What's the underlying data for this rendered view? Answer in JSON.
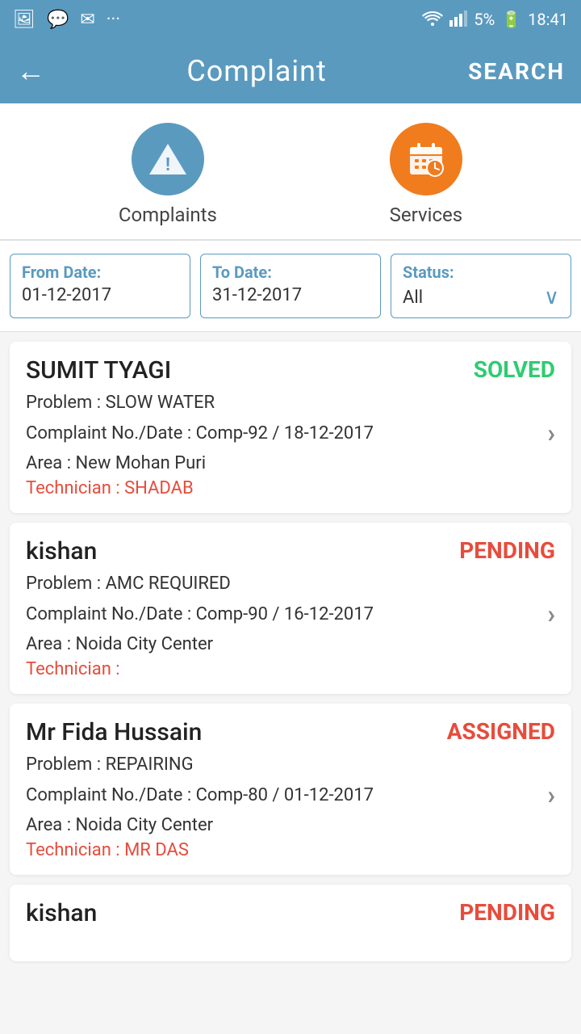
{
  "statusBar": {
    "time": "18:41",
    "battery": "5%",
    "icons": [
      "image",
      "chat",
      "mail",
      "more"
    ]
  },
  "header": {
    "title": "Complaint",
    "backLabel": "←",
    "searchLabel": "SEARCH"
  },
  "tabs": [
    {
      "id": "complaints",
      "label": "Complaints",
      "iconType": "warning",
      "color": "blue"
    },
    {
      "id": "services",
      "label": "Services",
      "iconType": "calendar-clock",
      "color": "orange"
    }
  ],
  "filters": {
    "fromDate": {
      "label": "From Date:",
      "value": "01-12-2017"
    },
    "toDate": {
      "label": "To Date:",
      "value": "31-12-2017"
    },
    "status": {
      "label": "Status:",
      "value": "All"
    }
  },
  "complaints": [
    {
      "id": 1,
      "name": "SUMIT TYAGI",
      "status": "SOLVED",
      "statusClass": "status-solved",
      "problem": "Problem : SLOW WATER",
      "complaintNo": "Complaint No./Date : Comp-92 / 18-12-2017",
      "area": "Area : New Mohan Puri",
      "technician": "Technician : SHADAB"
    },
    {
      "id": 2,
      "name": "kishan",
      "status": "PENDING",
      "statusClass": "status-pending",
      "problem": "Problem : AMC REQUIRED",
      "complaintNo": "Complaint No./Date : Comp-90 / 16-12-2017",
      "area": "Area : Noida City Center",
      "technician": "Technician :"
    },
    {
      "id": 3,
      "name": "Mr Fida Hussain",
      "status": "ASSIGNED",
      "statusClass": "status-assigned",
      "problem": "Problem : REPAIRING",
      "complaintNo": "Complaint No./Date : Comp-80 / 01-12-2017",
      "area": "Area : Noida City Center",
      "technician": "Technician : MR DAS"
    },
    {
      "id": 4,
      "name": "kishan",
      "status": "PENDING",
      "statusClass": "status-pending",
      "problem": "",
      "complaintNo": "",
      "area": "",
      "technician": ""
    }
  ]
}
